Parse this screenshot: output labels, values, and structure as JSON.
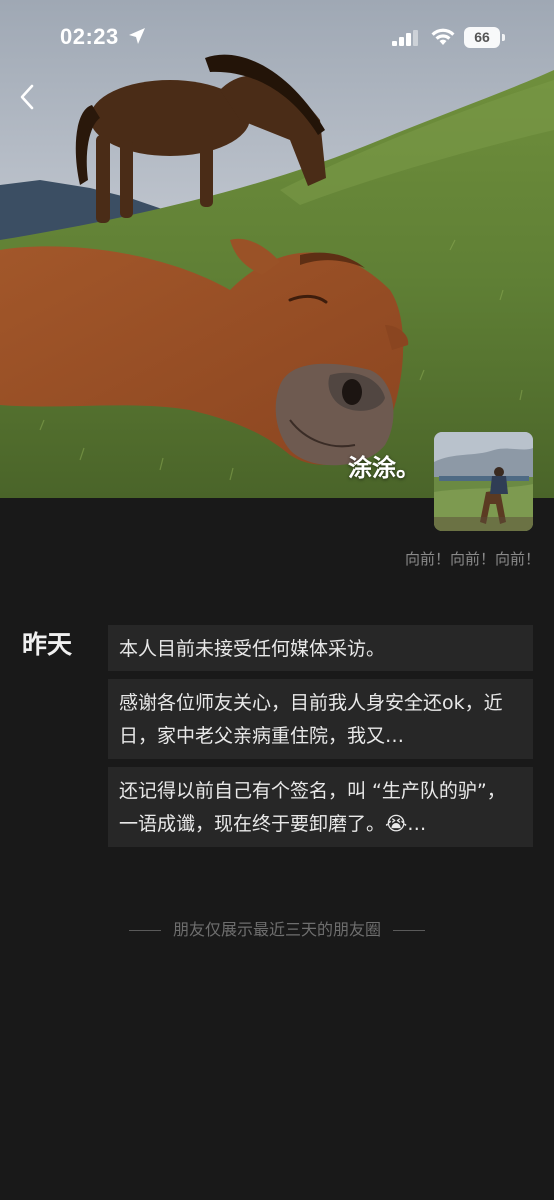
{
  "status_bar": {
    "time": "02:23",
    "battery": "66"
  },
  "profile": {
    "name": "涂涂。",
    "signature": "向前！向前！向前！"
  },
  "moments": {
    "day_label": "昨天",
    "posts": [
      {
        "text": "本人目前未接受任何媒体采访。"
      },
      {
        "text": "感谢各位师友关心，目前我人身安全还ok，近日，家中老父亲病重住院，我又…"
      },
      {
        "text": "还记得以前自己有个签名，叫 “生产队的驴”，一语成谶，现在终于要卸磨了。😭…"
      }
    ]
  },
  "footer": {
    "note": "朋友仅展示最近三天的朋友圈"
  },
  "icons": {
    "back": "chevron-left-icon",
    "location": "location-arrow-icon",
    "signal": "signal-icon",
    "wifi": "wifi-icon"
  }
}
